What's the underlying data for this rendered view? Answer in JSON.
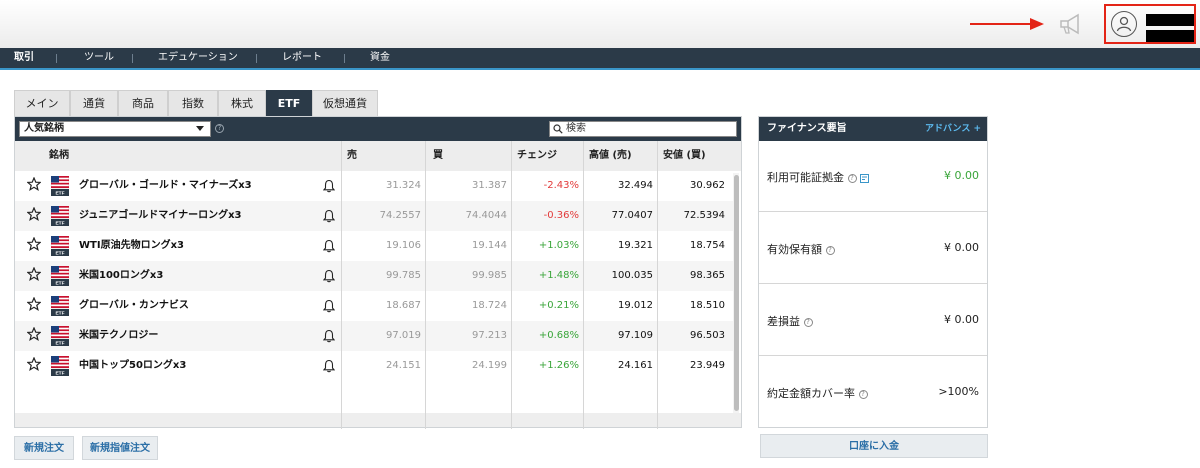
{
  "nav": {
    "items": [
      "取引",
      "ツール",
      "エデュケーション",
      "レポート",
      "資金"
    ],
    "active": "取引"
  },
  "tabs": [
    "メイン",
    "通貨",
    "商品",
    "指数",
    "株式",
    "ETF",
    "仮想通貨"
  ],
  "active_tab": "ETF",
  "filter": {
    "selected": "人気銘柄",
    "search_placeholder": "検索"
  },
  "table": {
    "headers": {
      "name": "銘柄",
      "sell": "売",
      "buy": "買",
      "change": "チェンジ",
      "high": "高値 (売)",
      "low": "安値 (買)"
    },
    "flag_badge": "ETF",
    "rows": [
      {
        "name": "グローバル・ゴールド・マイナーズx3",
        "sell": "31.324",
        "buy": "31.387",
        "change": "-2.43%",
        "high": "32.494",
        "low": "30.962"
      },
      {
        "name": "ジュニアゴールドマイナーロングx3",
        "sell": "74.2557",
        "buy": "74.4044",
        "change": "-0.36%",
        "high": "77.0407",
        "low": "72.5394"
      },
      {
        "name": "WTI原油先物ロングx3",
        "sell": "19.106",
        "buy": "19.144",
        "change": "+1.03%",
        "high": "19.321",
        "low": "18.754"
      },
      {
        "name": "米国100ロングx3",
        "sell": "99.785",
        "buy": "99.985",
        "change": "+1.48%",
        "high": "100.035",
        "low": "98.365"
      },
      {
        "name": "グローバル・カンナビス",
        "sell": "18.687",
        "buy": "18.724",
        "change": "+0.21%",
        "high": "19.012",
        "low": "18.510"
      },
      {
        "name": "米国テクノロジー",
        "sell": "97.019",
        "buy": "97.213",
        "change": "+0.68%",
        "high": "97.109",
        "low": "96.503"
      },
      {
        "name": "中国トップ50ロングx3",
        "sell": "24.151",
        "buy": "24.199",
        "change": "+1.26%",
        "high": "24.161",
        "low": "23.949"
      }
    ]
  },
  "buttons": {
    "new_order": "新規注文",
    "new_limit_order": "新規指値注文"
  },
  "summary": {
    "title": "ファイナンス要旨",
    "advanced": "アドバンス +",
    "available_margin_label": "利用可能証拠金",
    "available_margin_value": "¥ 0.00",
    "effective_holdings_label": "有効保有額",
    "effective_holdings_value": "¥ 0.00",
    "pnl_label": "差損益",
    "pnl_value": "¥ 0.00",
    "coverage_label": "約定金額カバー率",
    "coverage_value": ">100%",
    "deposit_button": "口座に入金"
  },
  "colors": {
    "nav_bg": "#2b3a48",
    "accent": "#3a96c9",
    "positive": "#3aa53a",
    "negative": "#e23b3b",
    "highlight_box": "#e32416"
  },
  "icons": [
    "red-arrow-icon",
    "megaphone-icon",
    "user-icon",
    "star-icon",
    "us-flag-icon",
    "bell-icon",
    "help-icon",
    "search-icon",
    "calculator-icon"
  ]
}
